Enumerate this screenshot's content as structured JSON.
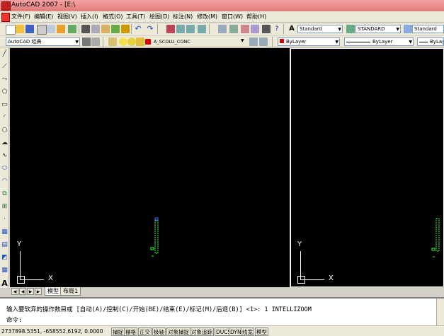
{
  "window": {
    "title": "AutoCAD 2007 - [E:\\"
  },
  "menubar": {
    "items": [
      "文件(F)",
      "编辑(E)",
      "视图(V)",
      "插入(I)",
      "格式(O)",
      "工具(T)",
      "绘图(D)",
      "标注(N)",
      "修改(M)",
      "窗口(W)",
      "帮助(H)"
    ]
  },
  "toolbar_styles": {
    "text_style": "Standard",
    "dim_style": "STANDARD",
    "table_style": "Standard"
  },
  "toolbar_layers": {
    "workspace": "AutoCAD 经典",
    "current_layer": "A_SCOLU_CONC",
    "color": "ByLayer",
    "linetype": "ByLayer",
    "lineweight": "ByLayer"
  },
  "left_tools": [
    "line-icon",
    "construction-line-icon",
    "polyline-icon",
    "polygon-icon",
    "rectangle-icon",
    "arc-icon",
    "circle-icon",
    "revision-cloud-icon",
    "spline-icon",
    "ellipse-icon",
    "ellipse-arc-icon",
    "insert-block-icon",
    "make-block-icon",
    "point-icon",
    "hatch-icon",
    "gradient-icon",
    "region-icon",
    "table-icon",
    "multiline-text-icon"
  ],
  "viewport": {
    "y_label": "Y",
    "x_label": "X"
  },
  "tabs": {
    "model": "模型",
    "layout1": "布局1"
  },
  "command": {
    "history": "输入要软弃的操作数目或 [自动(A)/控制(C)/开始(BE)/结束(E)/标记(M)/后退(B)] <1>: 1 INTELLIZOOM",
    "prompt": "命令:"
  },
  "status": {
    "coordinates": "2737898.5351, -658552.6192, 0.0000",
    "buttons": [
      "捕捉",
      "栅格",
      "正交",
      "极轴",
      "对象捕捉",
      "对象追踪",
      "DUCS",
      "DYN",
      "线宽",
      "模型"
    ]
  },
  "colors": {
    "viewport_bg": "#000000",
    "object_green": "#33ff33",
    "titlebar": "#e98b8b",
    "layer_color_swatch": "#e00000"
  }
}
